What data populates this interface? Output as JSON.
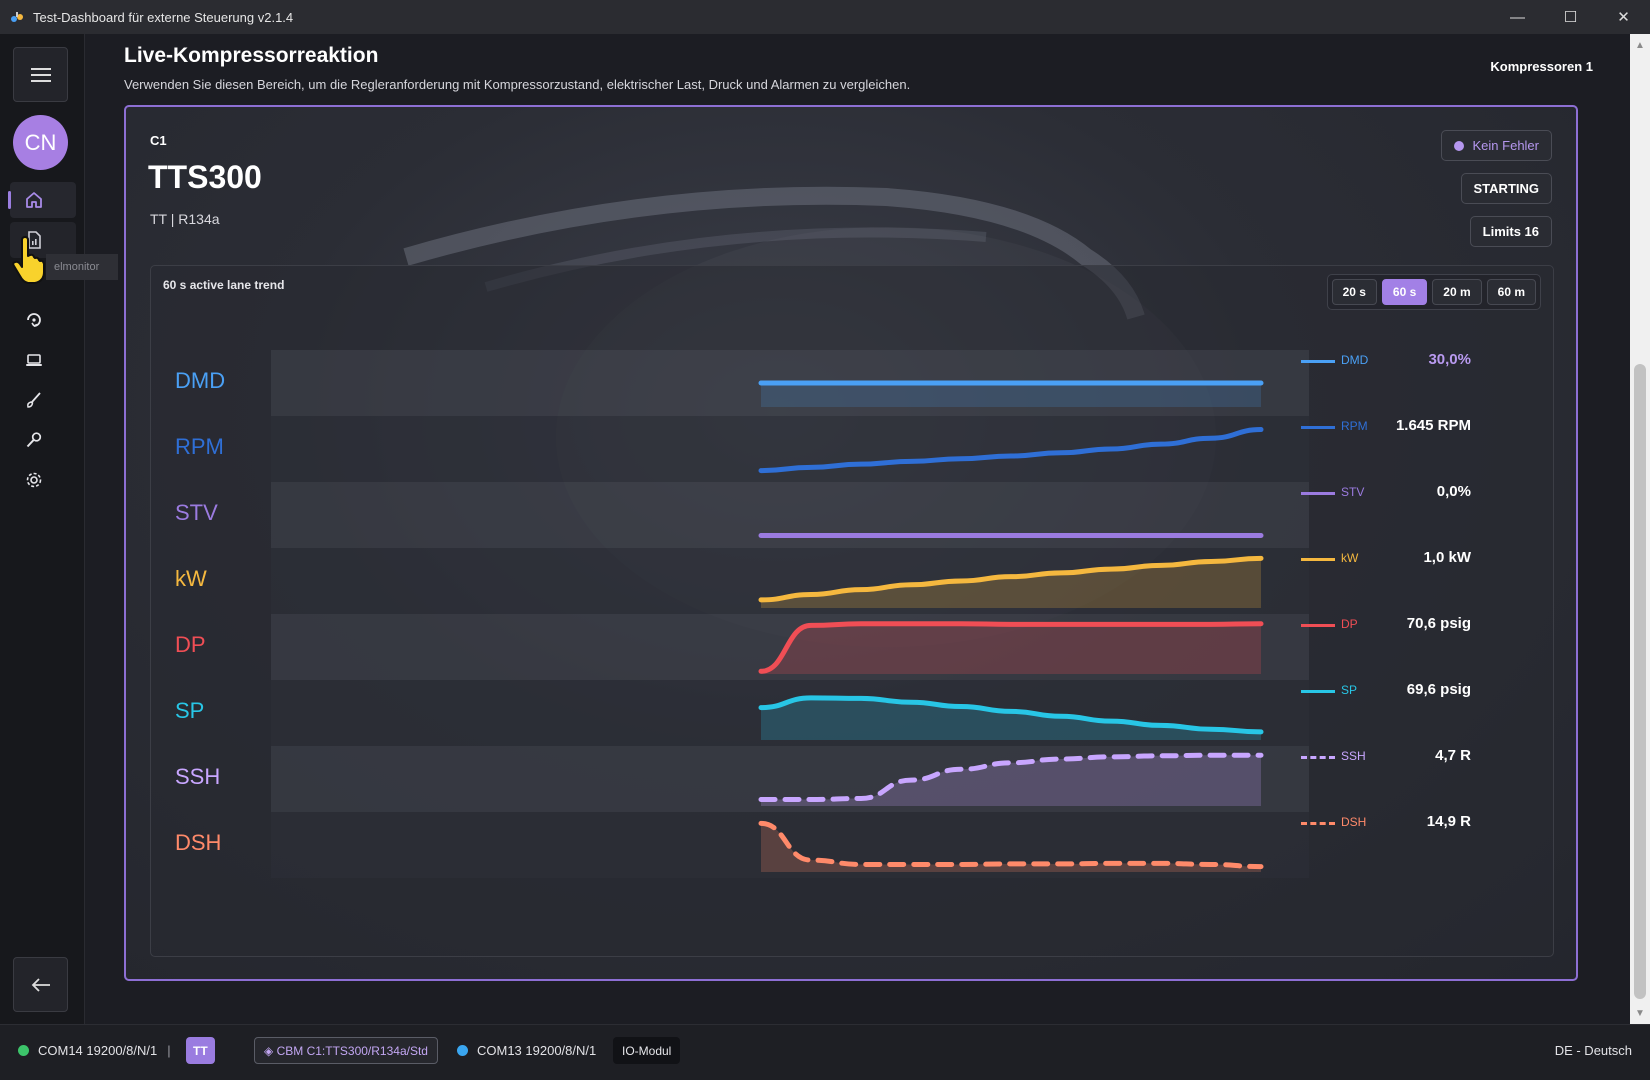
{
  "window": {
    "title": "Test-Dashboard für externe Steuerung v2.1.4",
    "controls": [
      "—",
      "☐",
      "✕"
    ]
  },
  "sidebar": {
    "avatar_initials": "CN",
    "tooltip": "elmonitor",
    "items": [
      {
        "name": "home-icon",
        "active": true
      },
      {
        "name": "report-icon",
        "active": false
      },
      {
        "name": "refresh-icon",
        "active": false
      },
      {
        "name": "laptop-icon",
        "active": false
      },
      {
        "name": "brush-icon",
        "active": false
      },
      {
        "name": "wrench-icon",
        "active": false
      },
      {
        "name": "gear-icon",
        "active": false
      }
    ]
  },
  "header": {
    "title": "Live-Kompressorreaktion",
    "subtitle": "Verwenden Sie diesen Bereich, um die Regleranforderung mit Kompressorzustand, elektrischer Last, Druck und Alarmen zu vergleichen.",
    "compressor_count": "Kompressoren 1"
  },
  "unit": {
    "code": "C1",
    "name": "TTS300",
    "meta": "TT  |  R134a",
    "fault_badge": "Kein Fehler",
    "state_badge": "STARTING",
    "limits_badge": "Limits 16"
  },
  "trend": {
    "title": "60 s active lane trend",
    "ranges": [
      {
        "label": "20 s",
        "active": false
      },
      {
        "label": "60 s",
        "active": true
      },
      {
        "label": "20 m",
        "active": false
      },
      {
        "label": "60 m",
        "active": false
      }
    ]
  },
  "chart_data": {
    "type": "line",
    "title": "60 s active lane trend",
    "xlabel": "",
    "ylabel": "",
    "grid": false,
    "legend_placement": "right",
    "series": [
      {
        "name": "DMD",
        "color": "#4aa0f5",
        "dashed": false,
        "fill": false,
        "value_label": "30,0%",
        "value_color": "#b99af0",
        "values": [
          0.5,
          0.5,
          0.5,
          0.5,
          0.5,
          0.5,
          0.5,
          0.5,
          0.5,
          0.5,
          0.5
        ]
      },
      {
        "name": "RPM",
        "color": "#2f6fd6",
        "dashed": false,
        "fill": false,
        "value_label": "1.645 RPM",
        "value_color": "#ffffff",
        "values": [
          0.1,
          0.16,
          0.22,
          0.27,
          0.32,
          0.37,
          0.43,
          0.5,
          0.59,
          0.7,
          0.86
        ]
      },
      {
        "name": "STV",
        "color": "#9b7be0",
        "dashed": false,
        "fill": false,
        "value_label": "0,0%",
        "value_color": "#ffffff",
        "values": [
          0.12,
          0.12,
          0.12,
          0.12,
          0.12,
          0.12,
          0.12,
          0.12,
          0.12,
          0.12,
          0.12
        ]
      },
      {
        "name": "kW",
        "color": "#f5b83f",
        "dashed": false,
        "fill": true,
        "value_label": "1,0 kW",
        "value_color": "#ffffff",
        "values": [
          0.15,
          0.25,
          0.34,
          0.43,
          0.5,
          0.58,
          0.65,
          0.72,
          0.79,
          0.86,
          0.92
        ]
      },
      {
        "name": "DP",
        "color": "#f04e55",
        "dashed": false,
        "fill": true,
        "value_label": "70,6 psig",
        "value_color": "#ffffff",
        "values": [
          0.05,
          0.9,
          0.93,
          0.93,
          0.93,
          0.92,
          0.92,
          0.92,
          0.92,
          0.92,
          0.93
        ]
      },
      {
        "name": "SP",
        "color": "#28c6e6",
        "dashed": false,
        "fill": true,
        "value_label": "69,6 psig",
        "value_color": "#ffffff",
        "values": [
          0.6,
          0.78,
          0.77,
          0.7,
          0.62,
          0.53,
          0.44,
          0.35,
          0.27,
          0.2,
          0.15
        ]
      },
      {
        "name": "SSH",
        "color": "#c8a6ff",
        "dashed": true,
        "fill": true,
        "value_label": "4,7 R",
        "value_color": "#ffffff",
        "values": [
          0.12,
          0.12,
          0.14,
          0.48,
          0.68,
          0.8,
          0.87,
          0.91,
          0.93,
          0.94,
          0.94
        ]
      },
      {
        "name": "DSH",
        "color": "#ff8a6a",
        "dashed": true,
        "fill": true,
        "value_label": "14,9 R",
        "value_color": "#ffffff",
        "values": [
          0.9,
          0.22,
          0.14,
          0.14,
          0.14,
          0.15,
          0.15,
          0.16,
          0.16,
          0.14,
          0.1
        ]
      }
    ]
  },
  "statusbar": {
    "port1": "COM14 19200/8/N/1",
    "port1_color": "#3cc46a",
    "separator": "|",
    "tt_tag": "TT",
    "cbm_tag": "◈ CBM C1:TTS300/R134a/Std",
    "port2": "COM13 19200/8/N/1",
    "port2_color": "#3aa6f0",
    "io_tag": "IO-Modul",
    "language": "DE - Deutsch"
  }
}
